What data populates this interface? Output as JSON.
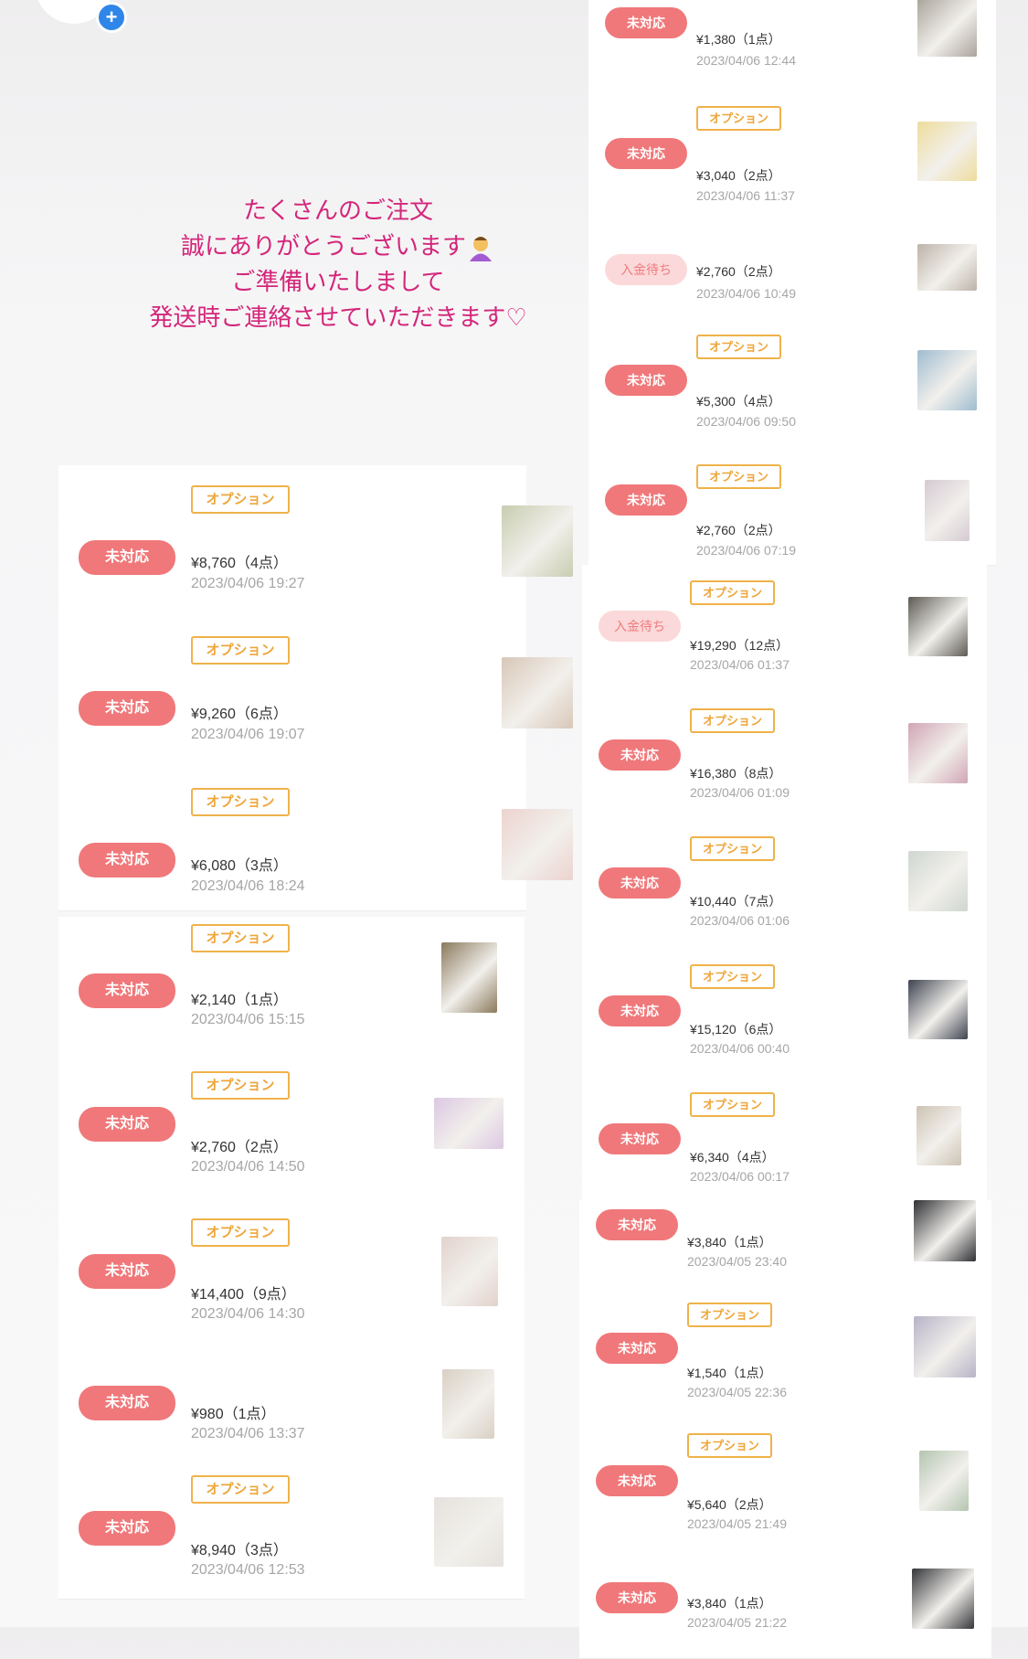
{
  "message": {
    "lines": [
      "たくさんのご注文",
      "誠にありがとうございます",
      "ご準備いたしまして",
      "発送時ご連絡させていただきます♡"
    ]
  },
  "orders_left": [
    {
      "status": "未対応",
      "option": "オプション",
      "price": "¥8,760（4点）",
      "date": "2023/04/06 19:27",
      "thumb_color": "#c8cdb0"
    },
    {
      "status": "未対応",
      "option": "オプション",
      "price": "¥9,260（6点）",
      "date": "2023/04/06 19:07",
      "thumb_color": "#d8c7b8"
    },
    {
      "status": "未対応",
      "option": "オプション",
      "price": "¥6,080（3点）",
      "date": "2023/04/06 18:24",
      "thumb_color": "#ecd3cf"
    },
    {
      "status": "未対応",
      "option": "オプション",
      "price": "¥2,140（1点）",
      "date": "2023/04/06 15:15",
      "thumb_color": "#8a7a5c"
    },
    {
      "status": "未対応",
      "option": "オプション",
      "price": "¥2,760（2点）",
      "date": "2023/04/06 14:50",
      "thumb_color": "#dcc8e2"
    },
    {
      "status": "未対応",
      "option": "オプション",
      "price": "¥14,400（9点）",
      "date": "2023/04/06 14:30",
      "thumb_color": "#e3d2cc"
    },
    {
      "status": "未対応",
      "option": "",
      "price": "¥980（1点）",
      "date": "2023/04/06 13:37",
      "thumb_color": "#d9d0c4"
    },
    {
      "status": "未対応",
      "option": "オプション",
      "price": "¥8,940（3点）",
      "date": "2023/04/06 12:53",
      "thumb_color": "#e5e2dd"
    }
  ],
  "orders_right": [
    {
      "status": "未対応",
      "option": "",
      "price": "¥1,380（1点）",
      "date": "2023/04/06 12:44",
      "thumb_color": "#a9a39a"
    },
    {
      "status": "未対応",
      "option": "オプション",
      "price": "¥3,040（2点）",
      "date": "2023/04/06 11:37",
      "thumb_color": "#eedc9c"
    },
    {
      "status": "入金待ち",
      "option": "",
      "price": "¥2,760（2点）",
      "date": "2023/04/06 10:49",
      "thumb_color": "#bdb3a8"
    },
    {
      "status": "未対応",
      "option": "オプション",
      "price": "¥5,300（4点）",
      "date": "2023/04/06 09:50",
      "thumb_color": "#9fbcd0"
    },
    {
      "status": "未対応",
      "option": "オプション",
      "price": "¥2,760（2点）",
      "date": "2023/04/06 07:19",
      "thumb_color": "#d5cad2"
    },
    {
      "status": "入金待ち",
      "option": "オプション",
      "price": "¥19,290（12点）",
      "date": "2023/04/06 01:37",
      "thumb_color": "#5c5a52"
    },
    {
      "status": "未対応",
      "option": "オプション",
      "price": "¥16,380（8点）",
      "date": "2023/04/06 01:09",
      "thumb_color": "#d0a5b5"
    },
    {
      "status": "未対応",
      "option": "オプション",
      "price": "¥10,440（7点）",
      "date": "2023/04/06 01:06",
      "thumb_color": "#cfd6d0"
    },
    {
      "status": "未対応",
      "option": "オプション",
      "price": "¥15,120（6点）",
      "date": "2023/04/06 00:40",
      "thumb_color": "#3e4350"
    },
    {
      "status": "未対応",
      "option": "オプション",
      "price": "¥6,340（4点）",
      "date": "2023/04/06 00:17",
      "thumb_color": "#cdc3b4"
    },
    {
      "status": "未対応",
      "option": "",
      "price": "¥3,840（1点）",
      "date": "2023/04/05 23:40",
      "thumb_color": "#2f3034"
    },
    {
      "status": "未対応",
      "option": "オプション",
      "price": "¥1,540（1点）",
      "date": "2023/04/05 22:36",
      "thumb_color": "#b8b3c7"
    },
    {
      "status": "未対応",
      "option": "オプション",
      "price": "¥5,640（2点）",
      "date": "2023/04/05 21:49",
      "thumb_color": "#b4c5b0"
    },
    {
      "status": "未対応",
      "option": "",
      "price": "¥3,840（1点）",
      "date": "2023/04/05 21:22",
      "thumb_color": "#35363a"
    }
  ]
}
